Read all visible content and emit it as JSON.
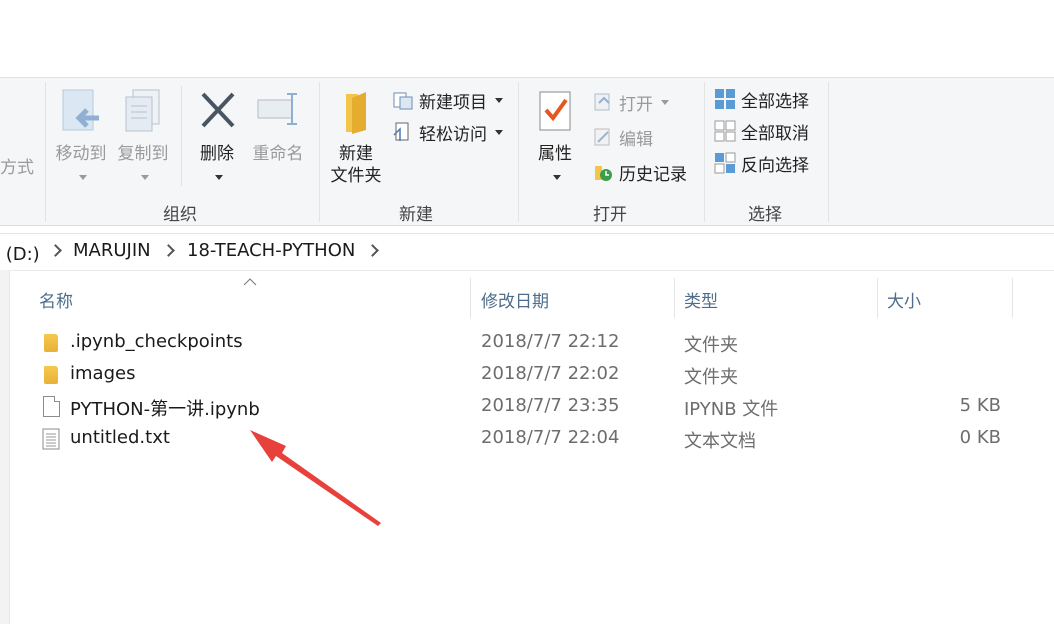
{
  "ribbon": {
    "partial_left_label": "方式",
    "organize": {
      "label": "组织",
      "move_to": "移动到",
      "copy_to": "复制到",
      "delete": "删除",
      "rename": "重命名"
    },
    "new": {
      "label": "新建",
      "new_folder_line1": "新建",
      "new_folder_line2": "文件夹",
      "new_item": "新建项目",
      "easy_access": "轻松访问"
    },
    "open": {
      "label": "打开",
      "properties": "属性",
      "open": "打开",
      "edit": "编辑",
      "history": "历史记录"
    },
    "select": {
      "label": "选择",
      "select_all": "全部选择",
      "select_none": "全部取消",
      "invert": "反向选择"
    }
  },
  "address": {
    "crumbs": [
      "卷 (D:)",
      "MARUJIN",
      "18-TEACH-PYTHON"
    ]
  },
  "list": {
    "columns": [
      "名称",
      "修改日期",
      "类型",
      "大小"
    ],
    "rows": [
      {
        "name": ".ipynb_checkpoints",
        "date": "2018/7/7 22:12",
        "type": "文件夹",
        "size": "",
        "icon": "folder-icon"
      },
      {
        "name": "images",
        "date": "2018/7/7 22:02",
        "type": "文件夹",
        "size": "",
        "icon": "folder-icon"
      },
      {
        "name": "PYTHON-第一讲.ipynb",
        "date": "2018/7/7 23:35",
        "type": "IPYNB 文件",
        "size": "5 KB",
        "icon": "file-icon"
      },
      {
        "name": "untitled.txt",
        "date": "2018/7/7 22:04",
        "type": "文本文档",
        "size": "0 KB",
        "icon": "text-file-icon"
      }
    ]
  },
  "annotation": {
    "arrow_color": "#e8403a"
  }
}
